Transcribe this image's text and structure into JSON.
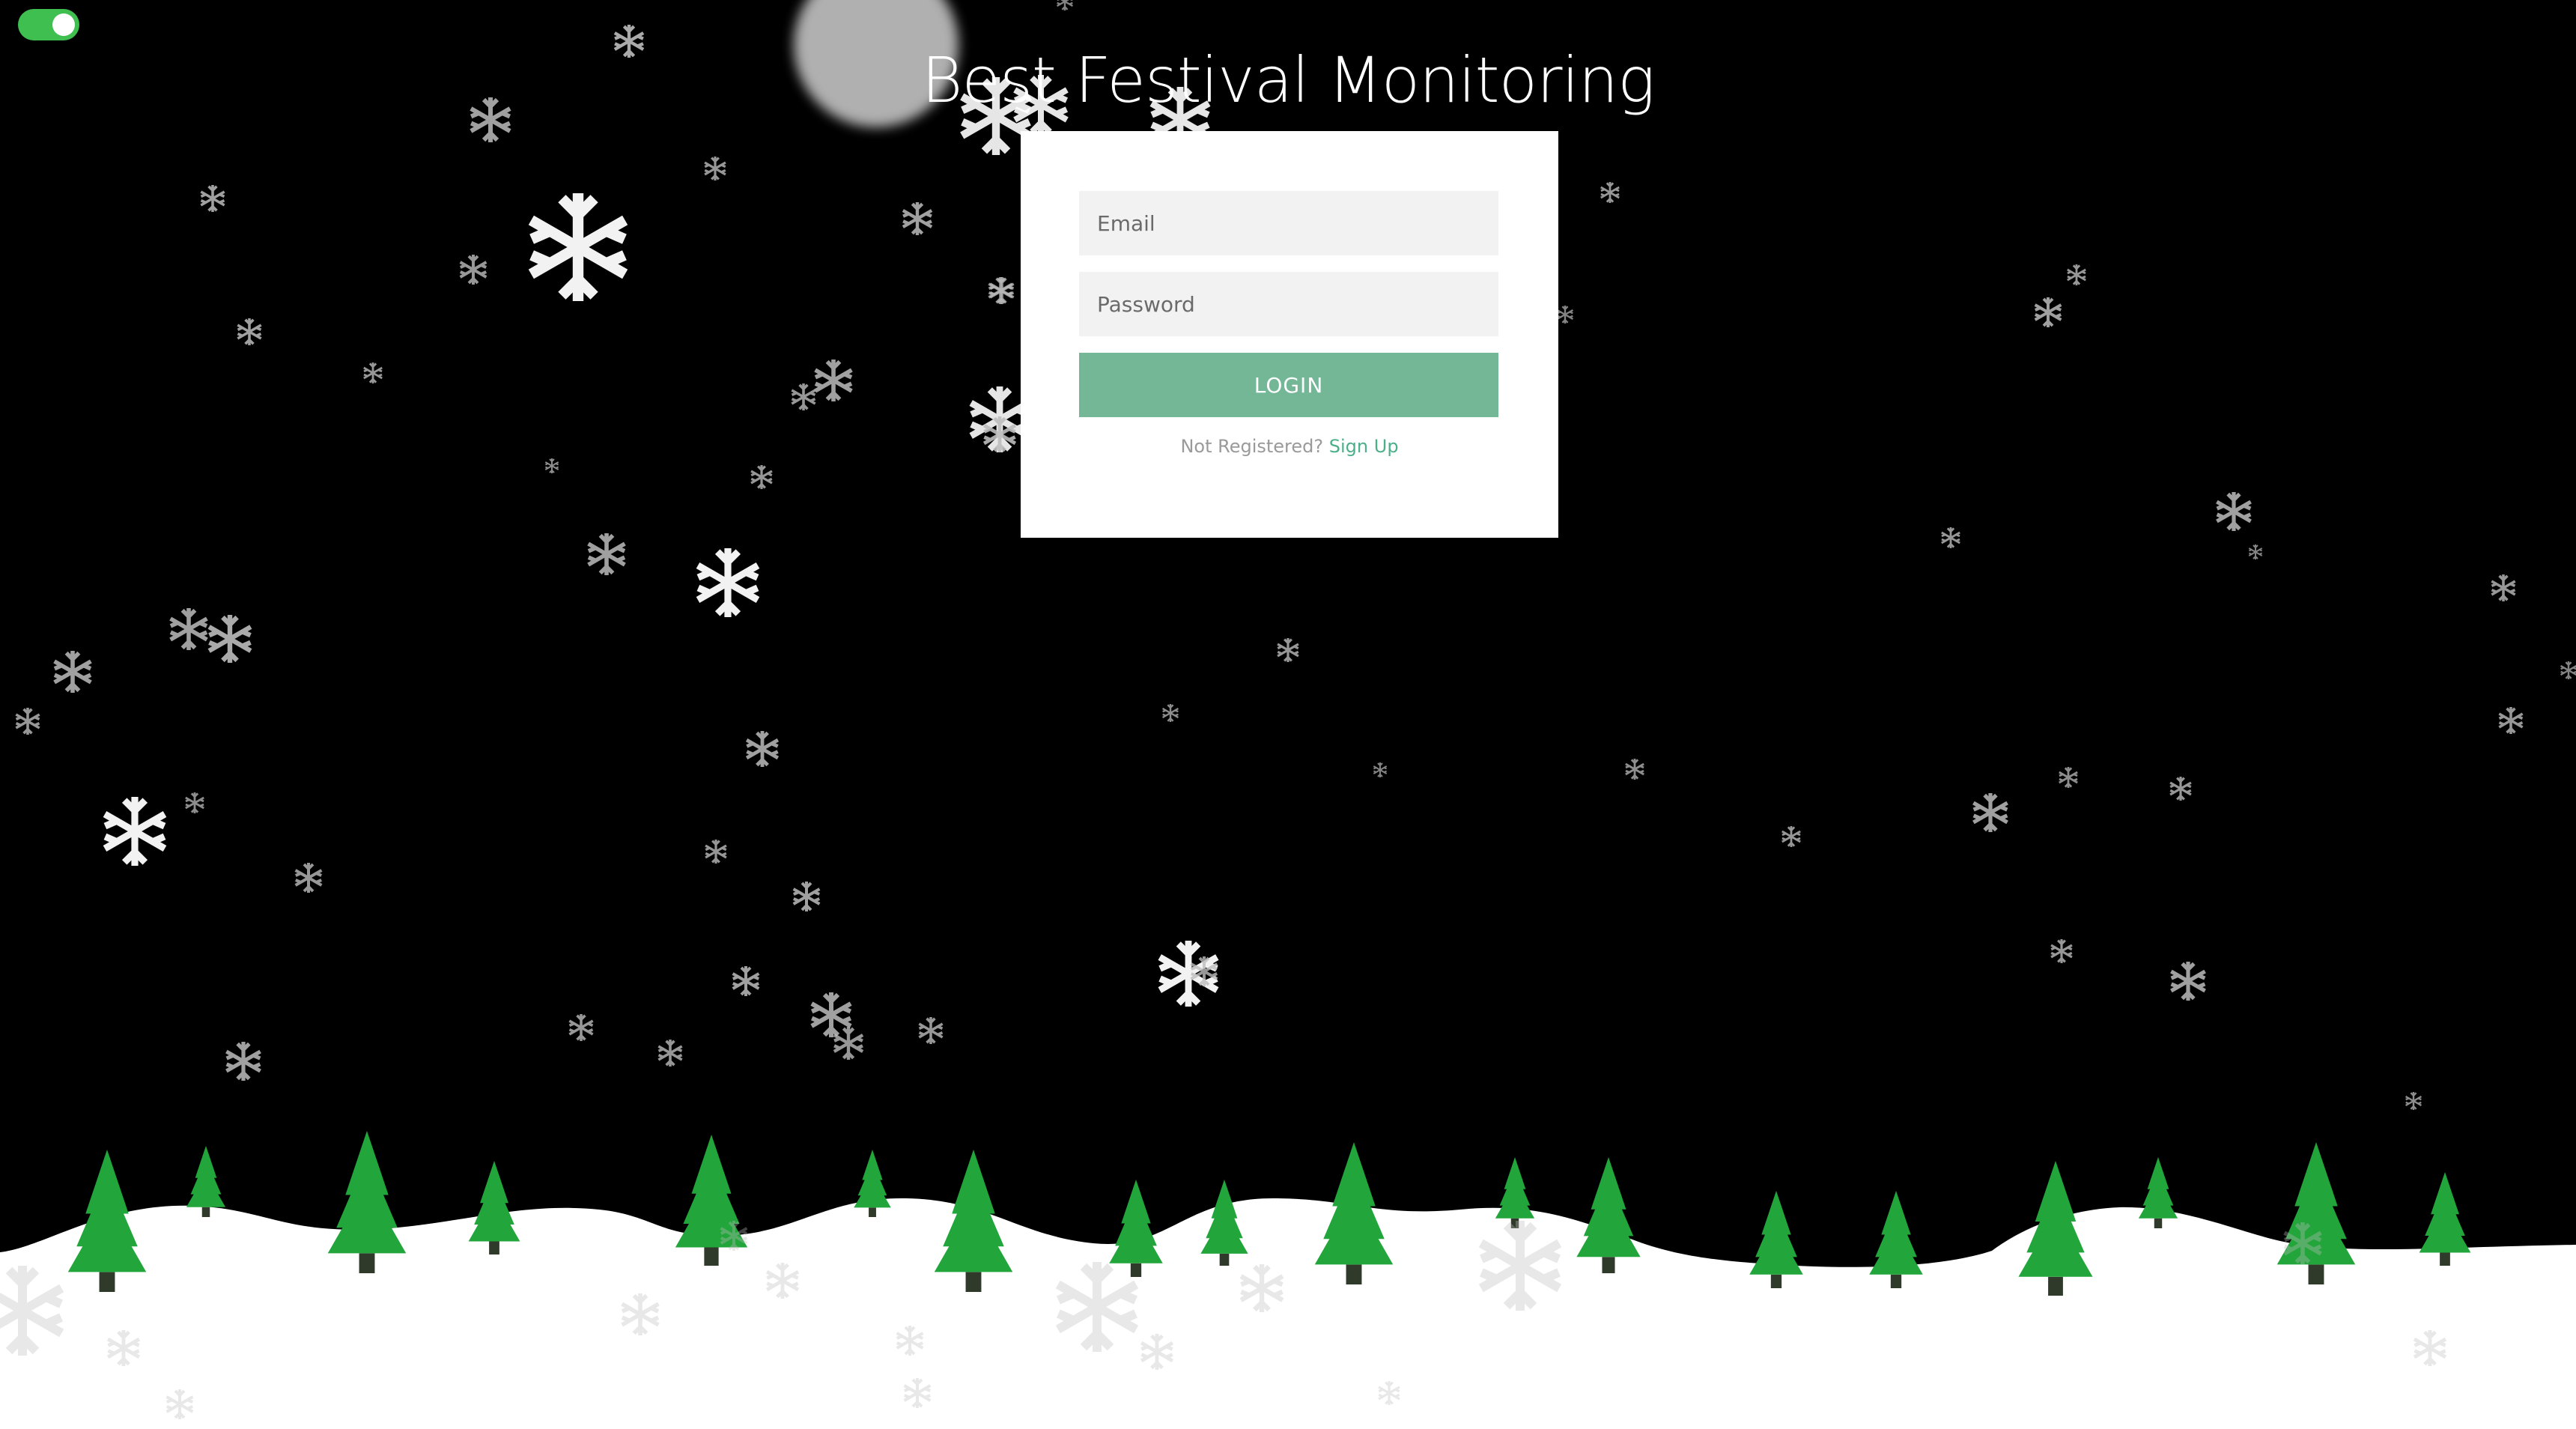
{
  "app": {
    "title": "Best Festival Monitoring"
  },
  "theme_toggle": {
    "state": "on",
    "color": "#3fbf4f"
  },
  "login_form": {
    "email_placeholder": "Email",
    "password_placeholder": "Password",
    "login_label": "LOGIN",
    "not_registered_text": "Not Registered?",
    "signup_label": "Sign Up",
    "button_color": "#73b797",
    "link_color": "#4caf8a"
  },
  "scene": {
    "background_color": "#000000",
    "snow_color": "#ffffff",
    "tree_color": "#22a53b",
    "trunk_color": "#2f3a2a"
  }
}
